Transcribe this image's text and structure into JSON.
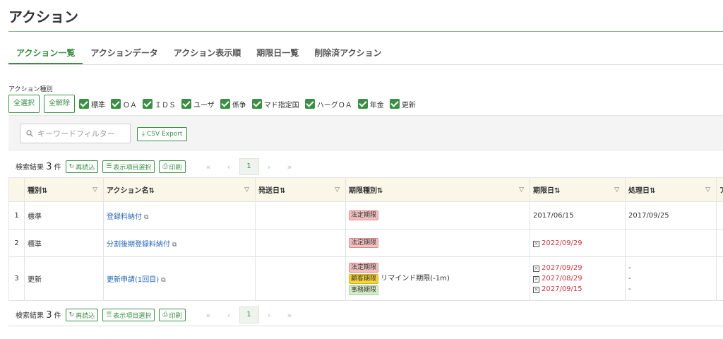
{
  "page": {
    "title": "アクション"
  },
  "tabs": [
    {
      "label": "アクション一覧",
      "active": true
    },
    {
      "label": "アクションデータ"
    },
    {
      "label": "アクション表示順"
    },
    {
      "label": "期限日一覧"
    },
    {
      "label": "削除済アクション"
    }
  ],
  "filter": {
    "label": "アクション種別",
    "select_all": "全選択",
    "clear_all": "全解除",
    "types": [
      "標準",
      "ＯＡ",
      "ＩＤＳ",
      "ユーザ",
      "係争",
      "マド指定国",
      "ハーグＯＡ",
      "年金",
      "更新"
    ]
  },
  "search": {
    "placeholder": "キーワードフィルター",
    "csv_label": "CSV Export"
  },
  "toolbar": {
    "count_prefix": "検索結果",
    "count": "3",
    "count_suffix": "件",
    "reload": "再読込",
    "columns": "表示項目選択",
    "print": "印刷",
    "first": "«",
    "prev": "‹",
    "page": "1",
    "next": "›",
    "last": "»"
  },
  "table": {
    "headers": [
      "種別",
      "アクション名",
      "発送日",
      "期限種別",
      "期限日",
      "処理日",
      "ア"
    ],
    "rows": [
      {
        "idx": "1",
        "type": "標準",
        "name": "登録料納付",
        "sent": "",
        "deadline_types": [
          {
            "label": "法定期限",
            "color": "red"
          }
        ],
        "deadline_note": "",
        "deadlines": [
          {
            "date": "2017/06/15",
            "overdue": false
          }
        ],
        "processed": [
          "2017/09/25"
        ]
      },
      {
        "idx": "2",
        "type": "標準",
        "name": "分割後期登録料納付",
        "sent": "",
        "deadline_types": [
          {
            "label": "法定期限",
            "color": "red"
          }
        ],
        "deadline_note": "",
        "deadlines": [
          {
            "date": "2022/09/29",
            "overdue": true
          }
        ],
        "processed": []
      },
      {
        "idx": "3",
        "type": "更新",
        "name": "更新申請(1回目)",
        "sent": "",
        "deadline_types": [
          {
            "label": "法定期限",
            "color": "red"
          },
          {
            "label": "顧客期限",
            "color": "yellow"
          },
          {
            "label": "事務期限",
            "color": "green"
          }
        ],
        "deadline_note": "リマインド期限(-1m)",
        "deadlines": [
          {
            "date": "2027/09/29",
            "overdue": true
          },
          {
            "date": "2027/08/29",
            "overdue": true
          },
          {
            "date": "2027/09/15",
            "overdue": true
          }
        ],
        "processed": [
          "-",
          "-",
          "-"
        ]
      }
    ]
  },
  "colors": {
    "accent": "#3a8f45",
    "link": "#2366b3",
    "overdue": "#c9393d",
    "header_bg": "#fbf7e8"
  }
}
